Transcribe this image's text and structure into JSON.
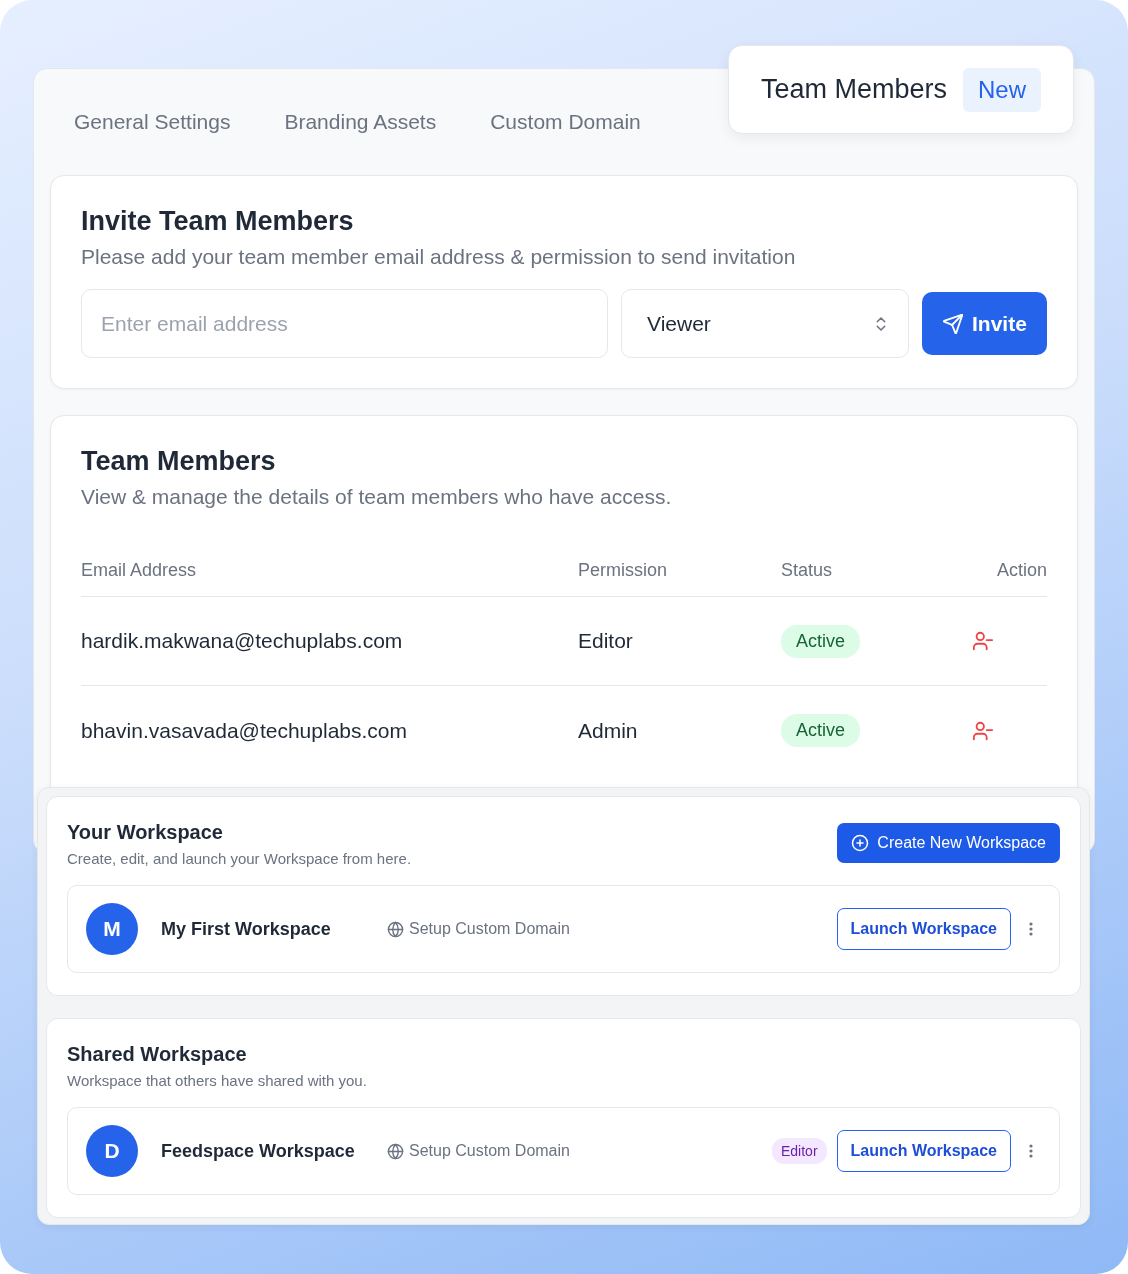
{
  "tabs": [
    {
      "label": "General Settings",
      "selected": false
    },
    {
      "label": "Branding Assets",
      "selected": false
    },
    {
      "label": "Custom Domain",
      "selected": false
    },
    {
      "label": "Team Members",
      "selected": true,
      "badge": "New"
    }
  ],
  "invite": {
    "title": "Invite Team Members",
    "subtitle": "Please add your team member email address & permission to send invitation",
    "email": {
      "placeholder": "Enter email address"
    },
    "permission": {
      "value": "Viewer"
    },
    "button": "Invite"
  },
  "team": {
    "title": "Team Members",
    "subtitle": "View & manage the details of team members who have access.",
    "columns": [
      "Email Address",
      "Permission",
      "Status",
      "Action"
    ],
    "rows": [
      {
        "email": "hardik.makwana@techuplabs.com",
        "permission": "Editor",
        "status": "Active"
      },
      {
        "email": "bhavin.vasavada@techuplabs.com",
        "permission": "Admin",
        "status": "Active"
      }
    ]
  },
  "workspaces": [
    {
      "title": "Your Workspace",
      "subtitle": "Create, edit, and launch your Workspace from here.",
      "button": "Create New Workspace",
      "items": [
        {
          "initial": "M",
          "name": "My First Workspace",
          "domain": "Setup Custom Domain",
          "launch": "Launch Workspace"
        }
      ]
    },
    {
      "title": "Shared Workspace",
      "subtitle": "Workspace that others have shared with you.",
      "items": [
        {
          "initial": "D",
          "name": "Feedspace Workspace",
          "domain": "Setup Custom Domain",
          "role": "Editor",
          "launch": "Launch Workspace"
        }
      ]
    }
  ]
}
